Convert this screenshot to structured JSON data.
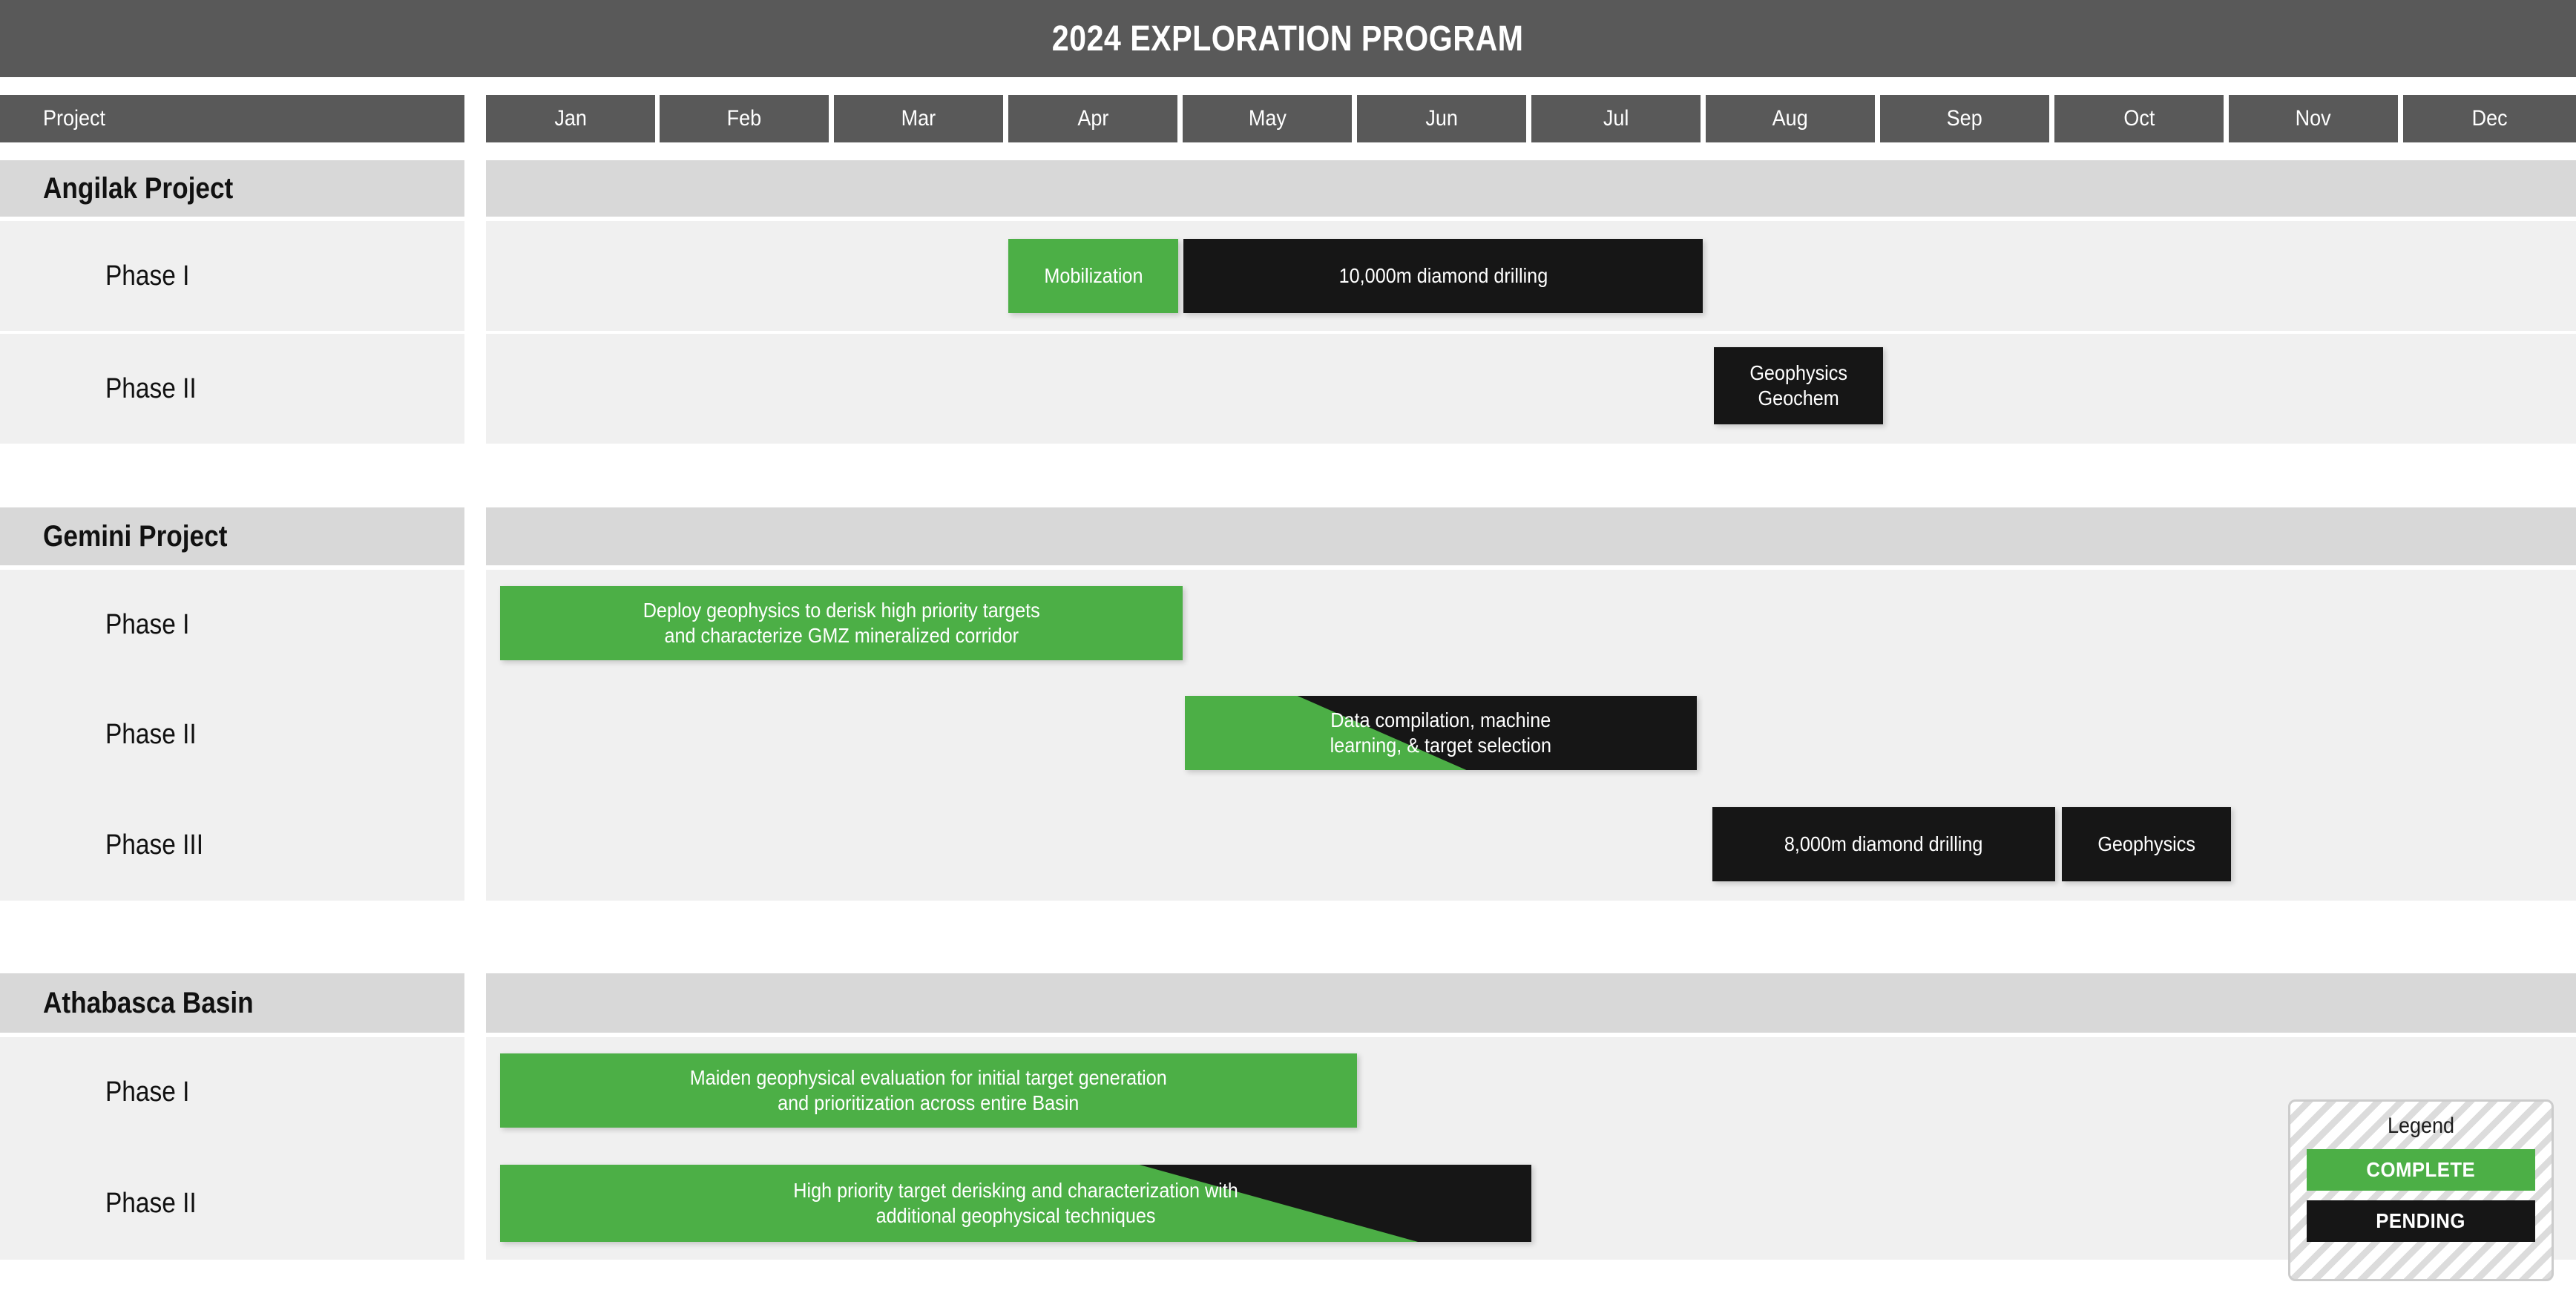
{
  "title": "2024 EXPLORATION PROGRAM",
  "colors": {
    "header_gray": "#595959",
    "section_band": "#d8d8d8",
    "row_bg": "#f0f0f0",
    "complete_green": "#4CAF46",
    "pending_black": "#161616"
  },
  "table": {
    "project_column_header": "Project",
    "months": [
      "Jan",
      "Feb",
      "Mar",
      "Apr",
      "May",
      "Jun",
      "Jul",
      "Aug",
      "Sep",
      "Oct",
      "Nov",
      "Dec"
    ]
  },
  "sections": [
    {
      "name": "Angilak Project",
      "rows": [
        {
          "label": "Phase I",
          "bars": [
            {
              "text": "Mobilization",
              "status": "complete",
              "start_month": "Apr",
              "end_month": "May"
            },
            {
              "text": "10,000m diamond drilling",
              "status": "pending",
              "start_month": "May",
              "end_month": "Aug"
            }
          ]
        },
        {
          "label": "Phase II",
          "bars": [
            {
              "text": "Geophysics\nGeochem",
              "status": "pending",
              "start_month": "Aug",
              "end_month": "Aug"
            }
          ]
        }
      ]
    },
    {
      "name": "Gemini Project",
      "rows": [
        {
          "label": "Phase I",
          "bars": [
            {
              "text": "Deploy geophysics to derisk high priority targets\nand characterize GMZ mineralized corridor",
              "status": "complete",
              "start_month": "Jan",
              "end_month": "Mar"
            }
          ]
        },
        {
          "label": "Phase II",
          "bars": [
            {
              "text": "Data compilation, machine\nlearning, & target selection",
              "status": "mixed",
              "start_month": "Apr",
              "end_month": "Jul"
            }
          ]
        },
        {
          "label": "Phase III",
          "bars": [
            {
              "text": "8,000m diamond drilling",
              "status": "pending",
              "start_month": "Aug",
              "end_month": "Sep"
            },
            {
              "text": "Geophysics",
              "status": "pending",
              "start_month": "Oct",
              "end_month": "Oct"
            }
          ]
        }
      ]
    },
    {
      "name": "Athabasca Basin",
      "rows": [
        {
          "label": "Phase I",
          "bars": [
            {
              "text": "Maiden geophysical evaluation for initial target generation\nand prioritization across entire Basin",
              "status": "complete",
              "start_month": "Jan",
              "end_month": "Apr"
            }
          ]
        },
        {
          "label": "Phase II",
          "bars": [
            {
              "text": "High priority target derisking and characterization with\nadditional geophysical techniques",
              "status": "mixed",
              "start_month": "Jan",
              "end_month": "May"
            }
          ]
        }
      ]
    }
  ],
  "legend": {
    "title": "Legend",
    "items": [
      {
        "label": "COMPLETE",
        "status": "complete"
      },
      {
        "label": "PENDING",
        "status": "pending"
      }
    ]
  }
}
